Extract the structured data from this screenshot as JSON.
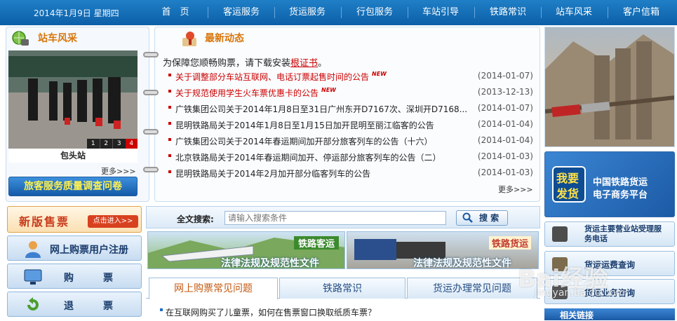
{
  "nav": {
    "date": "2014年1月9日 星期四",
    "items": [
      "首　页",
      "客运服务",
      "货运服务",
      "行包服务",
      "车站引导",
      "铁路常识",
      "站车风采",
      "客户信箱"
    ]
  },
  "station": {
    "title": "站车风采",
    "caption": "包头站",
    "more": "更多>>>",
    "pages": [
      "1",
      "2",
      "3",
      "4"
    ]
  },
  "survey": {
    "label": "旅客服务质量调查问卷"
  },
  "news": {
    "title": "最新动态",
    "notice_prefix": "为保障您顺畅购票，请下载安装",
    "notice_link": "根证书",
    "notice_suffix": "。",
    "items": [
      {
        "text": "关于调整部分车站互联网、电话订票起售时间的公告",
        "date": "(2014-01-07)",
        "new": "NEW",
        "red": true
      },
      {
        "text": "关于规范使用学生火车票优惠卡的公告",
        "date": "(2013-12-13)",
        "new": "NEW",
        "red": true
      },
      {
        "text": "广铁集团公司关于2014年1月8日至31日广州东开D7167次、深圳开D7168...",
        "date": "(2014-01-07)",
        "new": "",
        "red": false
      },
      {
        "text": "昆明铁路局关于2014年1月8日至1月15日加开昆明至丽江临客的公告",
        "date": "(2014-01-04)",
        "new": "",
        "red": false
      },
      {
        "text": "广铁集团公司关于2014年春运期间加开部分旅客列车的公告（十六）",
        "date": "(2014-01-04)",
        "new": "",
        "red": false
      },
      {
        "text": "北京铁路局关于2014年春运期间加开、停运部分旅客列车的公告（二）",
        "date": "(2014-01-03)",
        "new": "",
        "red": false
      },
      {
        "text": "昆明铁路局关于2014年2月加开部分临客列车的公告",
        "date": "(2014-01-03)",
        "new": "",
        "red": false
      }
    ],
    "more": "更多>>>"
  },
  "right": {
    "freight_banner": {
      "big1": "我要",
      "big2": "发货",
      "line1": "中国铁路货运",
      "line2": "电子商务平台"
    },
    "buttons": [
      "货运主要营业站受理服务电话",
      "货运运费查询",
      "货运业务咨询"
    ],
    "related": "相关链接"
  },
  "left_menu": {
    "new_ticket": "新版售票",
    "enter": "点击进入>>",
    "items": [
      "网上购票用户注册",
      "购　票",
      "退　票"
    ]
  },
  "search": {
    "label": "全文搜索:",
    "placeholder": "请输入搜索条件",
    "button": "搜 索"
  },
  "banners": [
    {
      "tag": "铁路客运",
      "caption": "法律法规及规范性文件"
    },
    {
      "tag": "铁路货运",
      "caption": "法律法规及规范性文件"
    }
  ],
  "tabs": [
    "网上购票常见问题",
    "铁路常识",
    "货运办理常见问题"
  ],
  "faq": [
    "在互联网购买了儿童票，如何在售票窗口换取纸质车票？"
  ],
  "watermark": {
    "text": "Bai经验",
    "sub": "jingyan.baidu.com"
  },
  "colors": {
    "nav": "#0c5fa8",
    "accent": "#d8760a",
    "link_red": "#cc0000"
  }
}
